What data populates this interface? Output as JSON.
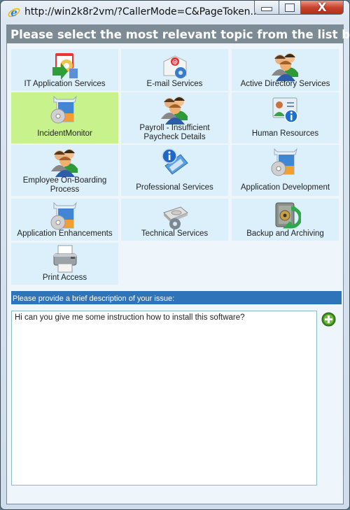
{
  "window": {
    "title": "http://win2k8r2vm/?CallerMode=C&PageToken...",
    "controls": {
      "minimize": "minimize",
      "maximize": "maximize",
      "close": "X"
    }
  },
  "header": {
    "title": "Please select the most relevant topic from the list below"
  },
  "topics": [
    {
      "label": "IT Application Services",
      "icon": "application-services-icon",
      "selected": false
    },
    {
      "label": "E-mail Services",
      "icon": "email-gear-icon",
      "selected": false
    },
    {
      "label": "Active Directory Services",
      "icon": "users-group-icon",
      "selected": false
    },
    {
      "label": "IncidentMonitor",
      "icon": "software-box-icon",
      "selected": true
    },
    {
      "label": "Payroll - Insufficient Paycheck Details",
      "icon": "users-group-icon",
      "selected": false
    },
    {
      "label": "Human Resources",
      "icon": "contact-card-info-icon",
      "selected": false
    },
    {
      "label": "Employee On-Boarding Process",
      "icon": "users-group-icon",
      "selected": false
    },
    {
      "label": "Professional Services",
      "icon": "info-document-icon",
      "selected": false
    },
    {
      "label": "Application Development",
      "icon": "software-box-icon",
      "selected": false
    },
    {
      "label": "Application Enhancements",
      "icon": "software-box-icon",
      "selected": false
    },
    {
      "label": "Technical Services",
      "icon": "hard-drive-gear-icon",
      "selected": false
    },
    {
      "label": "Backup and Archiving",
      "icon": "safe-backup-icon",
      "selected": false
    },
    {
      "label": "Print Access",
      "icon": "printer-icon",
      "selected": false
    }
  ],
  "description": {
    "label": "Please provide a brief description of your issue:",
    "value": "Hi can you give me some instruction how to install this software?"
  },
  "colors": {
    "header_bg": "#7c8b94",
    "tile_bg": "#dcf0fb",
    "tile_selected_bg": "#c8f28c",
    "desc_bar_bg": "#2f74b9",
    "add_button": "#4a9a2a"
  }
}
